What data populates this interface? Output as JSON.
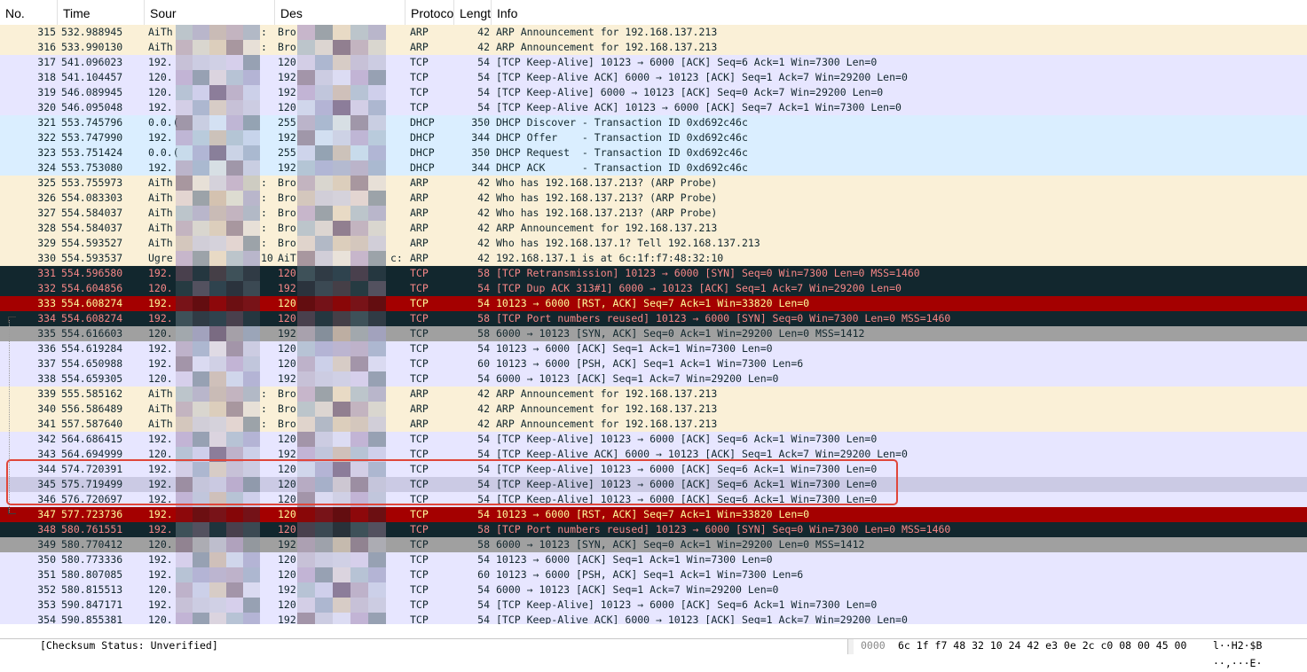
{
  "columns": [
    "No.",
    "Time",
    "Sour",
    "Des",
    "Protoco",
    "Lengt",
    "Info"
  ],
  "row_styles": {
    "arp": {
      "bg": "#faf0d7",
      "fg": "#12272e"
    },
    "tcp": {
      "bg": "#e7e6ff",
      "fg": "#12272e"
    },
    "dhcp": {
      "bg": "#daeeff",
      "fg": "#12272e"
    },
    "dark": {
      "bg": "#12272e",
      "fg": "#f78787"
    },
    "rst": {
      "bg": "#a40000",
      "fg": "#fffc9c"
    },
    "gray": {
      "bg": "#a0a0a0",
      "fg": "#12272e"
    },
    "sel": {
      "bg": "#cbcae4",
      "fg": "#12272e"
    }
  },
  "packets": [
    {
      "no": "315",
      "time": "532.988945",
      "src": "AiTh",
      "src2": ":",
      "dst": "Bro",
      "proto": "ARP",
      "len": "42",
      "info": "ARP Announcement for 192.168.137.213",
      "style": "arp"
    },
    {
      "no": "316",
      "time": "533.990130",
      "src": "AiTh",
      "src2": ":",
      "dst": "Bro",
      "proto": "ARP",
      "len": "42",
      "info": "ARP Announcement for 192.168.137.213",
      "style": "arp"
    },
    {
      "no": "317",
      "time": "541.096023",
      "src": "192.",
      "src2": "",
      "dst": "120",
      "proto": "TCP",
      "len": "54",
      "info": "[TCP Keep-Alive] 10123 → 6000 [ACK] Seq=6 Ack=1 Win=7300 Len=0",
      "style": "tcp"
    },
    {
      "no": "318",
      "time": "541.104457",
      "src": "120.",
      "src2": "",
      "dst": "192",
      "proto": "TCP",
      "len": "54",
      "info": "[TCP Keep-Alive ACK] 6000 → 10123 [ACK] Seq=1 Ack=7 Win=29200 Len=0",
      "style": "tcp"
    },
    {
      "no": "319",
      "time": "546.089945",
      "src": "120.",
      "src2": "",
      "dst": "192",
      "proto": "TCP",
      "len": "54",
      "info": "[TCP Keep-Alive] 6000 → 10123 [ACK] Seq=0 Ack=7 Win=29200 Len=0",
      "style": "tcp"
    },
    {
      "no": "320",
      "time": "546.095048",
      "src": "192.",
      "src2": "",
      "dst": "120",
      "proto": "TCP",
      "len": "54",
      "info": "[TCP Keep-Alive ACK] 10123 → 6000 [ACK] Seq=7 Ack=1 Win=7300 Len=0",
      "style": "tcp"
    },
    {
      "no": "321",
      "time": "553.745796",
      "src": "0.0.(",
      "src2": "",
      "dst": "255",
      "proto": "DHCP",
      "len": "350",
      "info": "DHCP Discover - Transaction ID 0xd692c46c",
      "style": "dhcp"
    },
    {
      "no": "322",
      "time": "553.747990",
      "src": "192.",
      "src2": "",
      "dst": "192",
      "proto": "DHCP",
      "len": "344",
      "info": "DHCP Offer    - Transaction ID 0xd692c46c",
      "style": "dhcp"
    },
    {
      "no": "323",
      "time": "553.751424",
      "src": "0.0.(",
      "src2": "",
      "dst": "255",
      "proto": "DHCP",
      "len": "350",
      "info": "DHCP Request  - Transaction ID 0xd692c46c",
      "style": "dhcp"
    },
    {
      "no": "324",
      "time": "553.753080",
      "src": "192.",
      "src2": "",
      "dst": "192",
      "proto": "DHCP",
      "len": "344",
      "info": "DHCP ACK      - Transaction ID 0xd692c46c",
      "style": "dhcp"
    },
    {
      "no": "325",
      "time": "553.755973",
      "src": "AiTh",
      "src2": ":",
      "dst": "Bro",
      "proto": "ARP",
      "len": "42",
      "info": "Who has 192.168.137.213? (ARP Probe)",
      "style": "arp"
    },
    {
      "no": "326",
      "time": "554.083303",
      "src": "AiTh",
      "src2": ":",
      "dst": "Bro",
      "proto": "ARP",
      "len": "42",
      "info": "Who has 192.168.137.213? (ARP Probe)",
      "style": "arp"
    },
    {
      "no": "327",
      "time": "554.584037",
      "src": "AiTh",
      "src2": ":",
      "dst": "Bro",
      "proto": "ARP",
      "len": "42",
      "info": "Who has 192.168.137.213? (ARP Probe)",
      "style": "arp"
    },
    {
      "no": "328",
      "time": "554.584037",
      "src": "AiTh",
      "src2": ":",
      "dst": "Bro",
      "proto": "ARP",
      "len": "42",
      "info": "ARP Announcement for 192.168.137.213",
      "style": "arp"
    },
    {
      "no": "329",
      "time": "554.593527",
      "src": "AiTh",
      "src2": ":",
      "dst": "Bro",
      "proto": "ARP",
      "len": "42",
      "info": "Who has 192.168.137.1? Tell 192.168.137.213",
      "style": "arp"
    },
    {
      "no": "330",
      "time": "554.593537",
      "src": "Ugre",
      "src2": "10",
      "dst": "AiT",
      "dst2": "c:",
      "proto": "ARP",
      "len": "42",
      "info": "192.168.137.1 is at 6c:1f:f7:48:32:10",
      "style": "arp"
    },
    {
      "no": "331",
      "time": "554.596580",
      "src": "192.",
      "src2": "",
      "dst": "120",
      "proto": "TCP",
      "len": "58",
      "info": "[TCP Retransmission] 10123 → 6000 [SYN] Seq=0 Win=7300 Len=0 MSS=1460",
      "style": "dark"
    },
    {
      "no": "332",
      "time": "554.604856",
      "src": "120.",
      "src2": "",
      "dst": "192",
      "proto": "TCP",
      "len": "54",
      "info": "[TCP Dup ACK 313#1] 6000 → 10123 [ACK] Seq=1 Ack=7 Win=29200 Len=0",
      "style": "dark"
    },
    {
      "no": "333",
      "time": "554.608274",
      "src": "192.",
      "src2": "",
      "dst": "120",
      "proto": "TCP",
      "len": "54",
      "info": "10123 → 6000 [RST, ACK] Seq=7 Ack=1 Win=33820 Len=0",
      "style": "rst"
    },
    {
      "no": "334",
      "time": "554.608274",
      "src": "192.",
      "src2": "",
      "dst": "120",
      "proto": "TCP",
      "len": "58",
      "info": "[TCP Port numbers reused] 10123 → 6000 [SYN] Seq=0 Win=7300 Len=0 MSS=1460",
      "style": "dark"
    },
    {
      "no": "335",
      "time": "554.616603",
      "src": "120.",
      "src2": "",
      "dst": "192",
      "proto": "TCP",
      "len": "58",
      "info": "6000 → 10123 [SYN, ACK] Seq=0 Ack=1 Win=29200 Len=0 MSS=1412",
      "style": "gray"
    },
    {
      "no": "336",
      "time": "554.619284",
      "src": "192.",
      "src2": "",
      "dst": "120",
      "proto": "TCP",
      "len": "54",
      "info": "10123 → 6000 [ACK] Seq=1 Ack=1 Win=7300 Len=0",
      "style": "tcp"
    },
    {
      "no": "337",
      "time": "554.650988",
      "src": "192.",
      "src2": "",
      "dst": "120",
      "proto": "TCP",
      "len": "60",
      "info": "10123 → 6000 [PSH, ACK] Seq=1 Ack=1 Win=7300 Len=6",
      "style": "tcp"
    },
    {
      "no": "338",
      "time": "554.659305",
      "src": "120.",
      "src2": "",
      "dst": "192",
      "proto": "TCP",
      "len": "54",
      "info": "6000 → 10123 [ACK] Seq=1 Ack=7 Win=29200 Len=0",
      "style": "tcp"
    },
    {
      "no": "339",
      "time": "555.585162",
      "src": "AiTh",
      "src2": ":",
      "dst": "Bro",
      "proto": "ARP",
      "len": "42",
      "info": "ARP Announcement for 192.168.137.213",
      "style": "arp"
    },
    {
      "no": "340",
      "time": "556.586489",
      "src": "AiTh",
      "src2": ":",
      "dst": "Bro",
      "proto": "ARP",
      "len": "42",
      "info": "ARP Announcement for 192.168.137.213",
      "style": "arp"
    },
    {
      "no": "341",
      "time": "557.587640",
      "src": "AiTh",
      "src2": ":",
      "dst": "Bro",
      "proto": "ARP",
      "len": "42",
      "info": "ARP Announcement for 192.168.137.213",
      "style": "arp"
    },
    {
      "no": "342",
      "time": "564.686415",
      "src": "192.",
      "src2": "",
      "dst": "120",
      "proto": "TCP",
      "len": "54",
      "info": "[TCP Keep-Alive] 10123 → 6000 [ACK] Seq=6 Ack=1 Win=7300 Len=0",
      "style": "tcp"
    },
    {
      "no": "343",
      "time": "564.694999",
      "src": "120.",
      "src2": "",
      "dst": "192",
      "proto": "TCP",
      "len": "54",
      "info": "[TCP Keep-Alive ACK] 6000 → 10123 [ACK] Seq=1 Ack=7 Win=29200 Len=0",
      "style": "tcp"
    },
    {
      "no": "344",
      "time": "574.720391",
      "src": "192.",
      "src2": "",
      "dst": "120",
      "proto": "TCP",
      "len": "54",
      "info": "[TCP Keep-Alive] 10123 → 6000 [ACK] Seq=6 Ack=1 Win=7300 Len=0",
      "style": "tcp"
    },
    {
      "no": "345",
      "time": "575.719499",
      "src": "192.",
      "src2": "",
      "dst": "120",
      "proto": "TCP",
      "len": "54",
      "info": "[TCP Keep-Alive] 10123 → 6000 [ACK] Seq=6 Ack=1 Win=7300 Len=0",
      "style": "sel"
    },
    {
      "no": "346",
      "time": "576.720697",
      "src": "192.",
      "src2": "",
      "dst": "120",
      "proto": "TCP",
      "len": "54",
      "info": "[TCP Keep-Alive] 10123 → 6000 [ACK] Seq=6 Ack=1 Win=7300 Len=0",
      "style": "tcp"
    },
    {
      "no": "347",
      "time": "577.723736",
      "src": "192.",
      "src2": "",
      "dst": "120",
      "proto": "TCP",
      "len": "54",
      "info": "10123 → 6000 [RST, ACK] Seq=7 Ack=1 Win=33820 Len=0",
      "style": "rst"
    },
    {
      "no": "348",
      "time": "580.761551",
      "src": "192.",
      "src2": "",
      "dst": "120",
      "proto": "TCP",
      "len": "58",
      "info": "[TCP Port numbers reused] 10123 → 6000 [SYN] Seq=0 Win=7300 Len=0 MSS=1460",
      "style": "dark"
    },
    {
      "no": "349",
      "time": "580.770412",
      "src": "120.",
      "src2": "",
      "dst": "192",
      "proto": "TCP",
      "len": "58",
      "info": "6000 → 10123 [SYN, ACK] Seq=0 Ack=1 Win=29200 Len=0 MSS=1412",
      "style": "gray"
    },
    {
      "no": "350",
      "time": "580.773336",
      "src": "192.",
      "src2": "",
      "dst": "120",
      "proto": "TCP",
      "len": "54",
      "info": "10123 → 6000 [ACK] Seq=1 Ack=1 Win=7300 Len=0",
      "style": "tcp"
    },
    {
      "no": "351",
      "time": "580.807085",
      "src": "192.",
      "src2": "",
      "dst": "120",
      "proto": "TCP",
      "len": "60",
      "info": "10123 → 6000 [PSH, ACK] Seq=1 Ack=1 Win=7300 Len=6",
      "style": "tcp"
    },
    {
      "no": "352",
      "time": "580.815513",
      "src": "120.",
      "src2": "",
      "dst": "192",
      "proto": "TCP",
      "len": "54",
      "info": "6000 → 10123 [ACK] Seq=1 Ack=7 Win=29200 Len=0",
      "style": "tcp"
    },
    {
      "no": "353",
      "time": "590.847171",
      "src": "192.",
      "src2": "",
      "dst": "120",
      "proto": "TCP",
      "len": "54",
      "info": "[TCP Keep-Alive] 10123 → 6000 [ACK] Seq=6 Ack=1 Win=7300 Len=0",
      "style": "tcp"
    },
    {
      "no": "354",
      "time": "590.855381",
      "src": "120.",
      "src2": "",
      "dst": "192",
      "proto": "TCP",
      "len": "54",
      "info": "[TCP Keep-Alive ACK] 6000 → 10123 [ACK] Seq=1 Ack=7 Win=29200 Len=0",
      "style": "tcp"
    }
  ],
  "detail_pane": {
    "text": "[Checksum Status: Unverified]"
  },
  "bytes_pane": {
    "offset": "0000",
    "hex": "6c 1f f7 48 32 10 24 42  e3 0e 2c c0 08 00 45 00",
    "ascii": "l··H2·$B ··,···E·"
  },
  "annotation": {
    "color": "#e0463a"
  }
}
